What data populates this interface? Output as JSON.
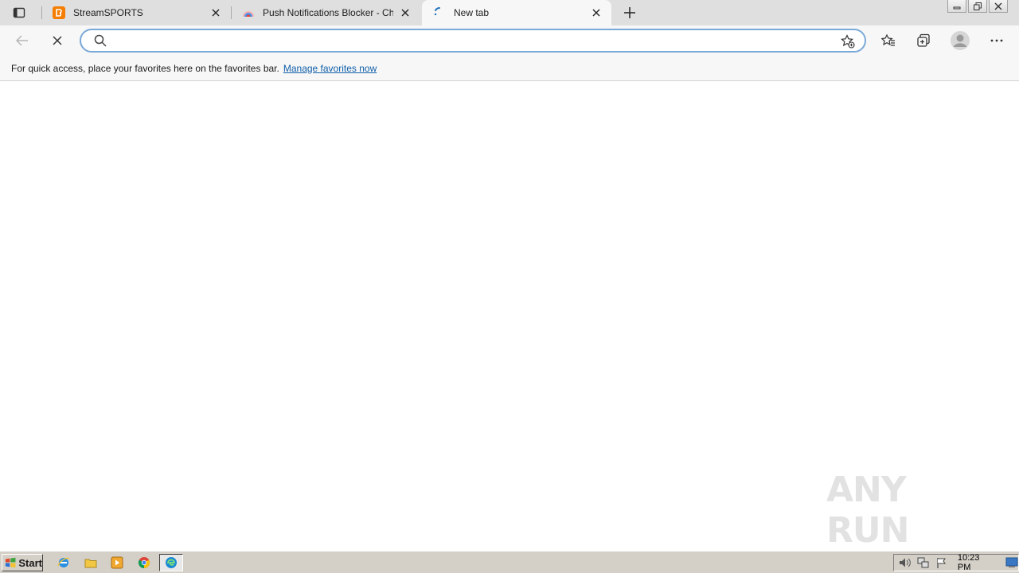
{
  "tabs": [
    {
      "title": "StreamSPORTS",
      "favicon": "blogger-icon"
    },
    {
      "title": "Push Notifications Blocker - Ch",
      "favicon": "chrome-web-store-icon"
    },
    {
      "title": "New tab",
      "favicon": "loading-spinner-icon"
    }
  ],
  "address_bar": {
    "value": "",
    "placeholder": ""
  },
  "favorites_bar": {
    "message": "For quick access, place your favorites here on the favorites bar.",
    "link": "Manage favorites now"
  },
  "watermark": "ANY RUN",
  "taskbar": {
    "start_label": "Start",
    "clock": "10:23 PM"
  },
  "colors": {
    "tab_strip": "#dfdfdf",
    "toolbar": "#f7f7f7",
    "link": "#0f5ea8",
    "focus_ring": "#7aa9d8",
    "taskbar": "#d4d0c8"
  }
}
